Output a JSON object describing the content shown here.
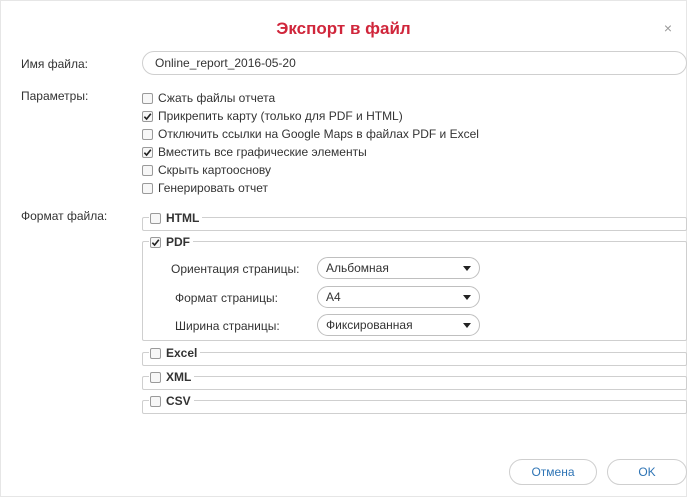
{
  "dialog": {
    "title": "Экспорт в файл",
    "close_glyph": "×"
  },
  "filename": {
    "label": "Имя файла:",
    "value": "Online_report_2016-05-20"
  },
  "params": {
    "label": "Параметры:",
    "options": [
      {
        "label": "Сжать файлы отчета",
        "checked": false
      },
      {
        "label": "Прикрепить карту (только для PDF и HTML)",
        "checked": true
      },
      {
        "label": "Отключить ссылки на Google Maps в файлах PDF и Excel",
        "checked": false
      },
      {
        "label": "Вместить все графические элементы",
        "checked": true
      },
      {
        "label": "Скрыть картооснову",
        "checked": false
      },
      {
        "label": "Генерировать отчет",
        "checked": false
      }
    ]
  },
  "format": {
    "label": "Формат файла:",
    "groups": [
      {
        "label": "HTML",
        "checked": false
      },
      {
        "label": "PDF",
        "checked": true
      },
      {
        "label": "Excel",
        "checked": false
      },
      {
        "label": "XML",
        "checked": false
      },
      {
        "label": "CSV",
        "checked": false
      }
    ],
    "pdf_options": {
      "orientation": {
        "label": "Ориентация страницы:",
        "value": "Альбомная"
      },
      "page_format": {
        "label": "Формат страницы:",
        "value": "A4"
      },
      "page_width": {
        "label": "Ширина страницы:",
        "value": "Фиксированная"
      }
    }
  },
  "buttons": {
    "cancel": "Отмена",
    "ok": "OK"
  },
  "colors": {
    "title": "#d0263b",
    "button_text": "#2e74b5"
  }
}
